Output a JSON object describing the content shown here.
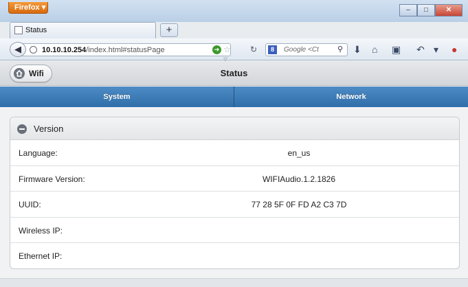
{
  "browser": {
    "app_button": "Firefox ▾",
    "tab_title": "Status",
    "new_tab": "+",
    "url_host": "10.10.10.254",
    "url_path": "/index.html#statusPage",
    "search_placeholder": "Google <Ct",
    "window_controls": [
      "–",
      "□",
      "✕"
    ]
  },
  "app": {
    "home_button_label": "Wifi",
    "title": "Status",
    "tabs": [
      {
        "label": "System"
      },
      {
        "label": "Network"
      }
    ],
    "panel": {
      "title": "Version",
      "rows": [
        {
          "label": "Language:",
          "value": "en_us"
        },
        {
          "label": "Firmware Version:",
          "value": "WIFIAudio.1.2.1826"
        },
        {
          "label": "UUID:",
          "value": "77 28 5F 0F FD A2 C3 7D"
        },
        {
          "label": "Wireless IP:",
          "value": ""
        },
        {
          "label": "Ethernet IP:",
          "value": ""
        }
      ]
    }
  },
  "colors": {
    "nav_blue": "#3a7bb8",
    "firefox_orange": "#e57f22"
  }
}
